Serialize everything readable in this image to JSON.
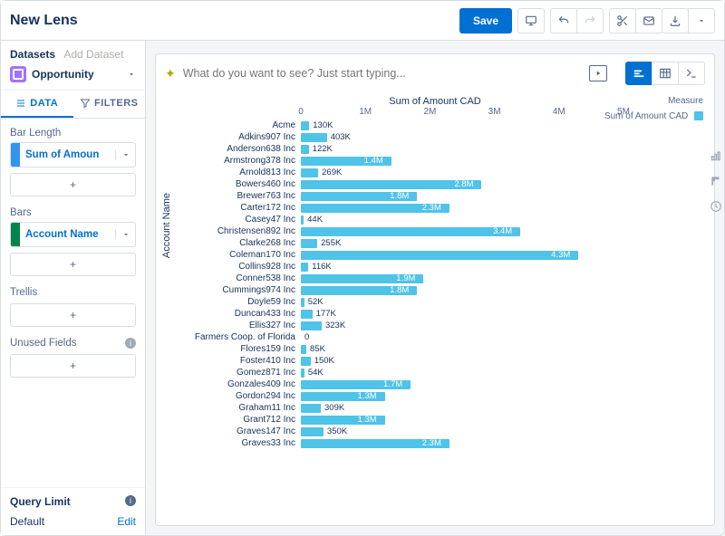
{
  "header": {
    "title": "New Lens",
    "save": "Save"
  },
  "sidebar": {
    "datasets_label": "Datasets",
    "add_dataset": "Add Dataset",
    "dataset_name": "Opportunity",
    "tabs": {
      "data": "DATA",
      "filters": "FILTERS"
    },
    "sections": {
      "bar_length": "Bar Length",
      "bars": "Bars",
      "trellis": "Trellis",
      "unused": "Unused Fields"
    },
    "pills": {
      "measure": "Sum of Amoun",
      "group": "Account Name"
    },
    "plus": "+",
    "query_limit": "Query Limit",
    "default": "Default",
    "edit": "Edit"
  },
  "ask": {
    "placeholder": "What do you want to see? Just start typing..."
  },
  "legend": {
    "title": "Measure",
    "series": "Sum of Amount CAD"
  },
  "chart_data": {
    "type": "bar",
    "title": "Sum of Amount CAD",
    "ylabel": "Account Name",
    "xlim": [
      0,
      5000000
    ],
    "ticks": [
      {
        "v": 0,
        "l": "0"
      },
      {
        "v": 1000000,
        "l": "1M"
      },
      {
        "v": 2000000,
        "l": "2M"
      },
      {
        "v": 3000000,
        "l": "3M"
      },
      {
        "v": 4000000,
        "l": "4M"
      },
      {
        "v": 5000000,
        "l": "5M"
      }
    ],
    "rows": [
      {
        "name": "Acme",
        "value": 130000,
        "label": "130K"
      },
      {
        "name": "Adkins907 Inc",
        "value": 403000,
        "label": "403K"
      },
      {
        "name": "Anderson638 Inc",
        "value": 122000,
        "label": "122K"
      },
      {
        "name": "Armstrong378 Inc",
        "value": 1400000,
        "label": "1.4M"
      },
      {
        "name": "Arnold813 Inc",
        "value": 269000,
        "label": "269K"
      },
      {
        "name": "Bowers460 Inc",
        "value": 2800000,
        "label": "2.8M"
      },
      {
        "name": "Brewer763 Inc",
        "value": 1800000,
        "label": "1.8M"
      },
      {
        "name": "Carter172 Inc",
        "value": 2300000,
        "label": "2.3M"
      },
      {
        "name": "Casey47 Inc",
        "value": 44000,
        "label": "44K"
      },
      {
        "name": "Christensen892 Inc",
        "value": 3400000,
        "label": "3.4M"
      },
      {
        "name": "Clarke268 Inc",
        "value": 255000,
        "label": "255K"
      },
      {
        "name": "Coleman170 Inc",
        "value": 4300000,
        "label": "4.3M"
      },
      {
        "name": "Collins928 Inc",
        "value": 116000,
        "label": "116K"
      },
      {
        "name": "Conner538 Inc",
        "value": 1900000,
        "label": "1.9M"
      },
      {
        "name": "Cummings974 Inc",
        "value": 1800000,
        "label": "1.8M"
      },
      {
        "name": "Doyle59 Inc",
        "value": 52000,
        "label": "52K"
      },
      {
        "name": "Duncan433 Inc",
        "value": 177000,
        "label": "177K"
      },
      {
        "name": "Ellis327 Inc",
        "value": 323000,
        "label": "323K"
      },
      {
        "name": "Farmers Coop. of Florida",
        "value": 0,
        "label": "0"
      },
      {
        "name": "Flores159 Inc",
        "value": 85000,
        "label": "85K"
      },
      {
        "name": "Foster410 Inc",
        "value": 150000,
        "label": "150K"
      },
      {
        "name": "Gomez871 Inc",
        "value": 54000,
        "label": "54K"
      },
      {
        "name": "Gonzales409 Inc",
        "value": 1700000,
        "label": "1.7M"
      },
      {
        "name": "Gordon294 Inc",
        "value": 1300000,
        "label": "1.3M"
      },
      {
        "name": "Graham11 Inc",
        "value": 309000,
        "label": "309K"
      },
      {
        "name": "Grant712 Inc",
        "value": 1300000,
        "label": "1.3M"
      },
      {
        "name": "Graves147 Inc",
        "value": 350000,
        "label": "350K"
      },
      {
        "name": "Graves33 Inc",
        "value": 2300000,
        "label": "2.3M"
      }
    ]
  }
}
